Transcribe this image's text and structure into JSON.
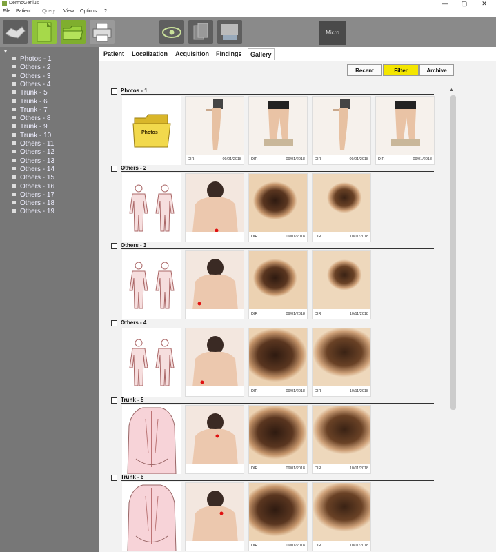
{
  "window": {
    "title": "DermoGenius",
    "minimize": "—",
    "maximize": "▢",
    "close": "✕"
  },
  "menu": [
    "File",
    "Patient",
    "Query",
    "View",
    "Options",
    "?"
  ],
  "toolbar": {
    "micro_label": "Micro"
  },
  "tree": {
    "root": "▾",
    "items": [
      "Photos - 1",
      "Others - 2",
      "Others - 3",
      "Others - 4",
      "Trunk - 5",
      "Trunk - 6",
      "Trunk - 7",
      "Others - 8",
      "Trunk - 9",
      "Trunk - 10",
      "Others - 11",
      "Others - 12",
      "Others - 13",
      "Others - 14",
      "Others - 15",
      "Others - 16",
      "Others - 17",
      "Others - 18",
      "Others - 19"
    ]
  },
  "tabs": [
    "Patient",
    "Localization",
    "Acquisition",
    "Findings",
    "Gallery"
  ],
  "view_buttons": {
    "recent": "Recent",
    "filter": "Filter",
    "archive": "Archive"
  },
  "folder_label": "Photos",
  "groups": [
    {
      "label": "Photos - 1",
      "images": [
        {
          "tag": "DIR",
          "date": "09/01/2018"
        },
        {
          "tag": "DIR",
          "date": "09/01/2018"
        },
        {
          "tag": "DIR",
          "date": "09/01/2018"
        },
        {
          "tag": "DIR",
          "date": "09/01/2018"
        }
      ]
    },
    {
      "label": "Others - 2",
      "images": [
        {
          "tag": "",
          "date": ""
        },
        {
          "tag": "DIR",
          "date": "09/01/2018"
        },
        {
          "tag": "DIR",
          "date": "10/11/2018"
        }
      ]
    },
    {
      "label": "Others - 3",
      "images": [
        {
          "tag": "",
          "date": ""
        },
        {
          "tag": "DIR",
          "date": "09/01/2018"
        },
        {
          "tag": "DIR",
          "date": "10/11/2018"
        }
      ]
    },
    {
      "label": "Others - 4",
      "images": [
        {
          "tag": "",
          "date": ""
        },
        {
          "tag": "DIR",
          "date": "09/01/2018"
        },
        {
          "tag": "DIR",
          "date": "10/11/2018"
        }
      ]
    },
    {
      "label": "Trunk - 5",
      "images": [
        {
          "tag": "",
          "date": ""
        },
        {
          "tag": "DIR",
          "date": "09/01/2018"
        },
        {
          "tag": "DIR",
          "date": "10/11/2018"
        }
      ]
    },
    {
      "label": "Trunk - 6",
      "images": [
        {
          "tag": "",
          "date": ""
        },
        {
          "tag": "DIR",
          "date": "09/01/2018"
        },
        {
          "tag": "DIR",
          "date": "10/11/2018"
        }
      ]
    }
  ],
  "colors": {
    "active_filter": "#f4e600",
    "sidebar_bg": "#777777",
    "toolbar_bg": "#8a8a8a"
  }
}
